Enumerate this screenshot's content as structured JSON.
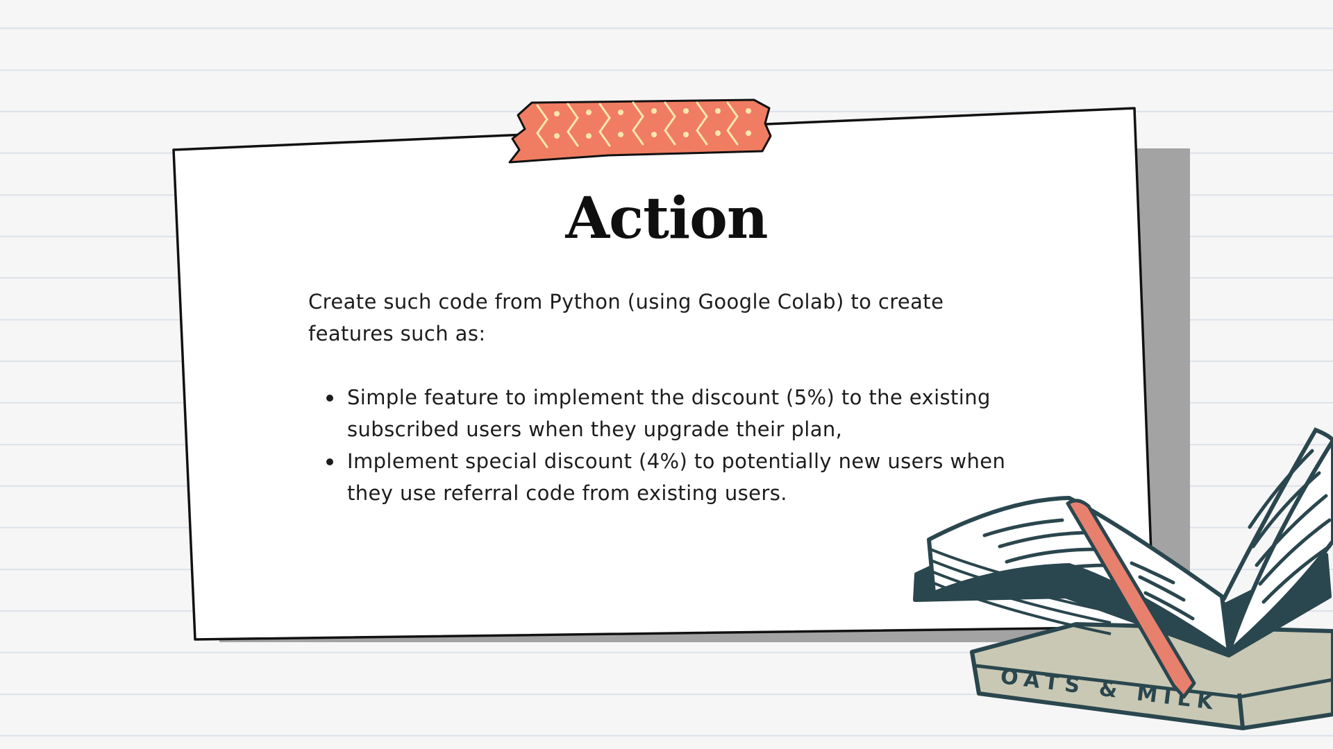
{
  "slide": {
    "title": "Action",
    "intro": "Create such code from Python (using Google Colab) to create features such as:",
    "bullets": [
      "Simple feature to implement the discount (5%) to the existing subscribed users when they upgrade their plan,",
      "Implement special discount (4%) to potentially new users when they use referral code from existing users."
    ]
  },
  "illustration": {
    "book_cover_text": "OATS & MILK",
    "icons": [
      "washi-tape-icon",
      "open-book-icon",
      "closed-book-icon"
    ]
  },
  "colors": {
    "tape": "#f07d62",
    "tape_pattern": "#fde7b0",
    "bookmark": "#e8806e",
    "book_outline": "#2a464e",
    "closed_book": "#c8c8b4",
    "card_shadow": "#a3a3a3",
    "ruled_line": "#dde2ea"
  }
}
